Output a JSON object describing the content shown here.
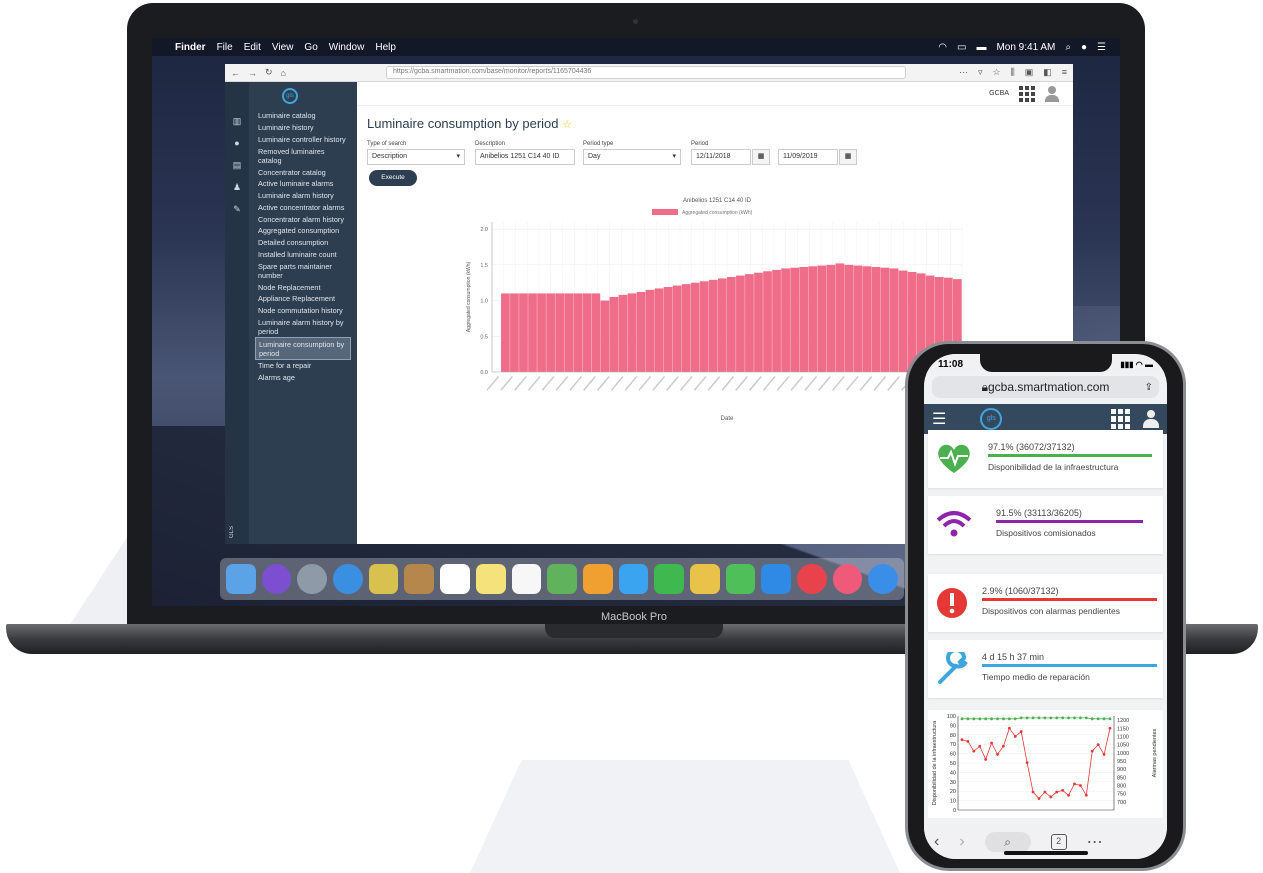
{
  "mac": {
    "menubar": {
      "app": "Finder",
      "items": [
        "File",
        "Edit",
        "View",
        "Go",
        "Window",
        "Help"
      ],
      "clock": "Mon 9:41 AM"
    },
    "model": "MacBook Pro",
    "browser": {
      "url": "https://gcba.smartmation.com/base/monitor/reports/1165704436"
    },
    "app": {
      "user": "GCBA",
      "menu": [
        "Luminaire catalog",
        "Luminaire history",
        "Luminaire controller history",
        "Removed luminaires catalog",
        "Concentrator catalog",
        "Active luminaire alarms",
        "Luminaire alarm history",
        "Active concentrator alarms",
        "Concentrator alarm history",
        "Aggregated consumption",
        "Detailed consumption",
        "Installed luminaire count",
        "Spare parts maintainer number",
        "Node Replacement",
        "Appliance Replacement",
        "Node commutation history",
        "Luminaire alarm history by period",
        "Luminaire consumption by period",
        "Time for a repair",
        "Alarms age"
      ],
      "active_menu_index": 17,
      "page_title": "Luminaire consumption by period",
      "form": {
        "type_label": "Type of search",
        "type_value": "Description",
        "desc_label": "Description",
        "desc_value": "Anibelios 1251 C14 40 ID",
        "period_type_label": "Period type",
        "period_type_value": "Day",
        "period_label": "Period",
        "date_from": "12/11/2018",
        "date_to": "11/09/2019",
        "execute": "Execute"
      }
    }
  },
  "phone": {
    "time": "11:08",
    "url": "gcba.smartmation.com",
    "tabs_count": "2",
    "cards": [
      {
        "value": "97.1% (36072/37132)",
        "label": "Disponibilidad de la infraestructura",
        "fill": 0.971,
        "color": "#4caf50",
        "icon": "heartbeat-icon"
      },
      {
        "value": "91.5% (33113/36205)",
        "label": "Dispositivos comisionados",
        "fill": 0.915,
        "color": "#8e24aa",
        "icon": "wifi-icon"
      },
      {
        "value": "2.9% (1060/37132)",
        "label": "Dispositivos con alarmas pendientes",
        "fill": 1.0,
        "color": "#e53935",
        "icon": "alert-icon"
      },
      {
        "value": "4 d 15 h 37 min",
        "label": "Tiempo medio de reparación",
        "fill": 1.0,
        "color": "#3fa6dd",
        "icon": "wrench-icon"
      }
    ]
  },
  "chart_data": [
    {
      "type": "bar",
      "title": "Anibelios 1251 C14 40 ID",
      "legend": "Aggregated consumption (kWh)",
      "xlabel": "Date",
      "ylabel": "Aggregated consumption (kWh)",
      "ylim": [
        0,
        2.1
      ],
      "yticks": [
        0,
        0.5,
        1.0,
        1.5,
        2.0
      ],
      "x_range": [
        "12/11/2018",
        "11/09/2019"
      ],
      "series": [
        {
          "values": [
            0,
            1.1,
            1.1,
            1.1,
            1.1,
            1.1,
            1.1,
            1.1,
            1.1,
            1.1,
            1.1,
            1.1,
            1.0,
            1.05,
            1.08,
            1.1,
            1.12,
            1.15,
            1.17,
            1.19,
            1.21,
            1.23,
            1.25,
            1.27,
            1.29,
            1.31,
            1.33,
            1.35,
            1.37,
            1.39,
            1.41,
            1.43,
            1.45,
            1.46,
            1.47,
            1.48,
            1.49,
            1.5,
            1.52,
            1.5,
            1.49,
            1.48,
            1.47,
            1.46,
            1.45,
            1.42,
            1.4,
            1.38,
            1.35,
            1.33,
            1.32,
            1.3
          ]
        }
      ],
      "color": "#f06d8a"
    },
    {
      "type": "line",
      "ylabel": "Disponibilidad de la infraestructura",
      "y2label": "Alarmas pendientes",
      "ylim": [
        0,
        100
      ],
      "y2lim": [
        650,
        1225
      ],
      "yticks": [
        0,
        10,
        20,
        30,
        40,
        50,
        60,
        70,
        80,
        90,
        100
      ],
      "y2ticks": [
        700,
        750,
        800,
        850,
        900,
        950,
        1000,
        1050,
        1100,
        1150,
        1200
      ],
      "series": [
        {
          "axis": "left",
          "color": "#4caf50",
          "values": [
            97,
            97,
            97,
            97,
            97,
            97,
            97,
            97,
            97,
            97,
            98,
            98,
            98,
            98,
            98,
            98,
            98,
            98,
            98,
            98,
            98,
            98,
            97,
            97,
            97,
            97
          ]
        },
        {
          "axis": "right",
          "color": "#e53935",
          "values": [
            1080,
            1070,
            1010,
            1040,
            960,
            1060,
            990,
            1040,
            1150,
            1100,
            1130,
            940,
            760,
            720,
            760,
            730,
            760,
            770,
            740,
            810,
            800,
            740,
            1010,
            1050,
            990,
            1150
          ]
        }
      ]
    }
  ]
}
